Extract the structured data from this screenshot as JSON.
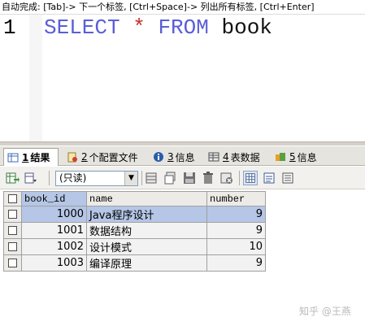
{
  "hint": "自动完成: [Tab]-> 下一个标签, [Ctrl+Space]-> 列出所有标签, [Ctrl+Enter]",
  "editor": {
    "line_number": "1",
    "tokens": {
      "kw1": "SELECT",
      "star": "*",
      "kw2": "FROM",
      "table": "book"
    }
  },
  "tabs": [
    {
      "num": "1",
      "label": "结果"
    },
    {
      "num": "2",
      "label": "个配置文件"
    },
    {
      "num": "3",
      "label": "信息"
    },
    {
      "num": "4",
      "label": "表数据"
    },
    {
      "num": "5",
      "label": "信息"
    }
  ],
  "toolbar": {
    "mode": "(只读)"
  },
  "table": {
    "headers": [
      "book_id",
      "name",
      "number"
    ],
    "rows": [
      {
        "book_id": "1000",
        "name": "Java程序设计",
        "number": "9"
      },
      {
        "book_id": "1001",
        "name": "数据结构",
        "number": "9"
      },
      {
        "book_id": "1002",
        "name": "设计模式",
        "number": "10"
      },
      {
        "book_id": "1003",
        "name": "编译原理",
        "number": "9"
      }
    ]
  },
  "watermark": "知乎 @王燕",
  "colors": {
    "keyword": "#5a5ed8",
    "operator": "#c0302b",
    "selection": "#b5c6e6"
  }
}
